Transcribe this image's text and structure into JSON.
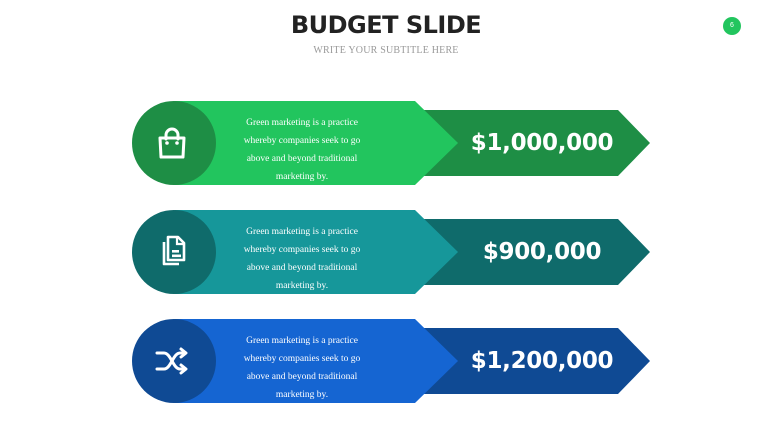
{
  "header": {
    "title": "BUDGET SLIDE",
    "subtitle": "WRITE YOUR SUBTITLE HERE",
    "page_number": "6"
  },
  "rows": [
    {
      "icon": "shopping-bag-icon",
      "description": "Green marketing is a practice whereby companies seek to go above and beyond traditional marketing by.",
      "amount": "$1,000,000",
      "colors": {
        "circle": "#1e8e45",
        "band": "#22c55e",
        "arrow": "#1e8e45"
      }
    },
    {
      "icon": "documents-icon",
      "description": "Green marketing is a practice whereby companies seek to go above and beyond traditional marketing by.",
      "amount": "$900,000",
      "colors": {
        "circle": "#0f6b6b",
        "band": "#16979a",
        "arrow": "#0f6b6b"
      }
    },
    {
      "icon": "shuffle-icon",
      "description": "Green marketing is a practice whereby companies seek to go above and beyond traditional marketing by.",
      "amount": "$1,200,000",
      "colors": {
        "circle": "#0f4a94",
        "band": "#1565d2",
        "arrow": "#0f4a94"
      }
    }
  ]
}
